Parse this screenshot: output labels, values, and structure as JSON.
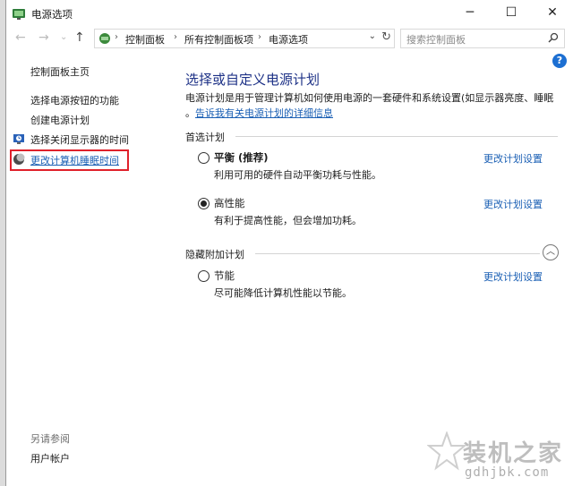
{
  "window": {
    "title": "电源选项",
    "buttons": {
      "minimize": "─",
      "maximize": "☐",
      "close": "✕"
    }
  },
  "address_bar": {
    "crumbs": [
      "控制面板",
      "所有控制面板项",
      "电源选项"
    ],
    "search_placeholder": "搜索控制面板"
  },
  "help_label": "?",
  "sidebar": {
    "home": "控制面板主页",
    "items": [
      {
        "label": "选择电源按钮的功能",
        "icon": ""
      },
      {
        "label": "创建电源计划",
        "icon": ""
      },
      {
        "label": "选择关闭显示器的时间",
        "icon": "monitor-clock-icon"
      },
      {
        "label": "更改计算机睡眠时间",
        "icon": "moon-icon"
      }
    ],
    "see_also": "另请参阅",
    "user_accounts": "用户帐户"
  },
  "main": {
    "title": "选择或自定义电源计划",
    "description": "电源计划是用于管理计算机如何使用电源的一套硬件和系统设置(如显示器亮度、睡眠",
    "description_link_prefix": "。",
    "description_link": "告诉我有关电源计划的详细信息",
    "preferred_label": "首选计划",
    "hidden_label": "隐藏附加计划",
    "change_label": "更改计划设置",
    "plans": [
      {
        "name": "平衡 (推荐)",
        "desc": "利用可用的硬件自动平衡功耗与性能。",
        "checked": false
      },
      {
        "name": "高性能",
        "desc": "有利于提高性能，但会增加功耗。",
        "checked": true
      },
      {
        "name": "节能",
        "desc": "尽可能降低计算机性能以节能。",
        "checked": false
      }
    ]
  },
  "watermark": {
    "text": "装机之家",
    "url": "gdhjbk.com"
  }
}
